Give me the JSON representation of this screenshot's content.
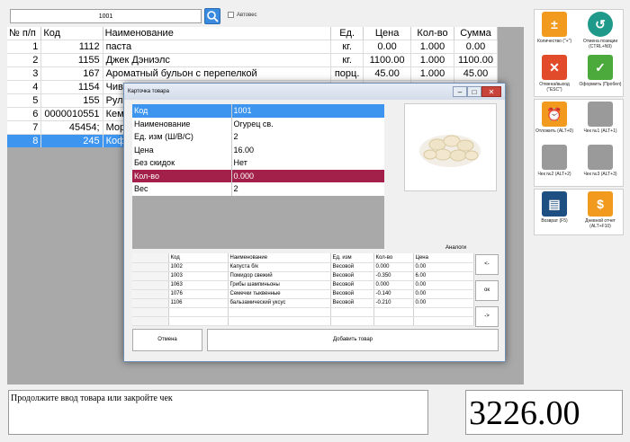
{
  "search": {
    "value": "1001",
    "autoves_label": "Автовес"
  },
  "colors": {
    "selection": "#3d95f0",
    "qty_row": "#a3204a",
    "gray_panel": "#a9a9a9"
  },
  "sales": {
    "headers": [
      "№ п/п",
      "Код",
      "Наименование",
      "Ед.",
      "Цена",
      "Кол-во",
      "Сумма"
    ],
    "rows": [
      {
        "n": "1",
        "code": "1112",
        "name": "паста",
        "unit": "кг.",
        "price": "0.00",
        "qty": "1.000",
        "sum": "0.00"
      },
      {
        "n": "2",
        "code": "1155",
        "name": "Джек Дэниэлс",
        "unit": "кг.",
        "price": "1100.00",
        "qty": "1.000",
        "sum": "1100.00"
      },
      {
        "n": "3",
        "code": "167",
        "name": "Ароматный бульон с перепелкой",
        "unit": "порц.",
        "price": "45.00",
        "qty": "1.000",
        "sum": "45.00"
      },
      {
        "n": "4",
        "code": "1154",
        "name": "Чив",
        "unit": "",
        "price": "",
        "qty": "",
        "sum": ""
      },
      {
        "n": "5",
        "code": "155",
        "name": "Рул",
        "unit": "",
        "price": "",
        "qty": "",
        "sum": ""
      },
      {
        "n": "6",
        "code": "0000010551",
        "name": "Кем",
        "unit": "",
        "price": "",
        "qty": "",
        "sum": ""
      },
      {
        "n": "7",
        "code": "45454;",
        "name": "Мор",
        "unit": "",
        "price": "",
        "qty": "",
        "sum": ""
      },
      {
        "n": "8",
        "code": "245",
        "name": "Коф",
        "unit": "",
        "price": "",
        "qty": "",
        "sum": ""
      }
    ]
  },
  "buttons": {
    "quantity": "Количество (\"+\")",
    "cancel_position": "Отмена позиции (CTRL+N9)",
    "cancel_exit": "Отмена/выход (\"ESC\")",
    "checkout": "Оформить (Пробел)",
    "defer": "Отложить (ALT+0)",
    "check1": "Чек №1 (ALT+1)",
    "check2": "Чек №2 (ALT+2)",
    "check3": "Чек №3 (ALT+3)",
    "return": "Возврат (F5)",
    "daily_report": "Дневной отчет (ALT+F10)"
  },
  "status": {
    "message": "Продолжите ввод товара или закройте чек",
    "total": "3226.00"
  },
  "modal": {
    "title": "Карточка товара",
    "fields": [
      {
        "k": "Код",
        "v": "1001"
      },
      {
        "k": "Наименование",
        "v": "Огурец св."
      },
      {
        "k": "Ед. изм (Ш/В/С)",
        "v": "2"
      },
      {
        "k": "Цена",
        "v": "16.00"
      },
      {
        "k": "Без скидок",
        "v": "Нет"
      },
      {
        "k": "Кол-во",
        "v": "0.000"
      },
      {
        "k": "Вес",
        "v": "2"
      }
    ],
    "analogs_label": "Аналоги",
    "analog_headers": [
      "Код",
      "Наименование",
      "Ед. изм",
      "Кол-во",
      "Цена"
    ],
    "analogs": [
      {
        "code": "1002",
        "name": "Капуста б/к",
        "unit": "Весовой",
        "qty": "0.000",
        "price": "0.00"
      },
      {
        "code": "1003",
        "name": "Помидор свежий",
        "unit": "Весовой",
        "qty": "-0.350",
        "price": "6.00"
      },
      {
        "code": "1063",
        "name": "Грибы шампиньоны",
        "unit": "Весовой",
        "qty": "0.000",
        "price": "0.00"
      },
      {
        "code": "1076",
        "name": "Семечки тыквенные",
        "unit": "Весовой",
        "qty": "-0.140",
        "price": "0.00"
      },
      {
        "code": "1106",
        "name": "бальзамический уксус",
        "unit": "Весовой",
        "qty": "-0.210",
        "price": "0.00"
      }
    ],
    "nav_prev": "<-",
    "ok": "ок",
    "nav_next": "->",
    "cancel": "Отмена",
    "add": "Добавить товар"
  }
}
